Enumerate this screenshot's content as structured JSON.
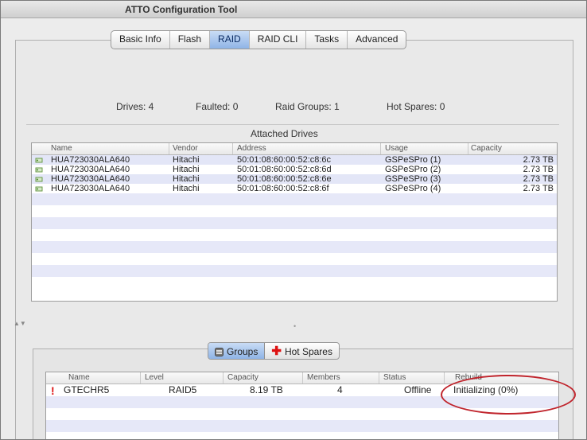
{
  "window": {
    "title": "ATTO Configuration Tool"
  },
  "tabs": [
    {
      "label": "Basic Info",
      "active": false
    },
    {
      "label": "Flash",
      "active": false
    },
    {
      "label": "RAID",
      "active": true
    },
    {
      "label": "RAID CLI",
      "active": false
    },
    {
      "label": "Tasks",
      "active": false
    },
    {
      "label": "Advanced",
      "active": false
    }
  ],
  "summary": {
    "drives": "Drives:  4",
    "faulted": "Faulted:  0",
    "raid_groups": "Raid Groups:  1",
    "hot_spares": "Hot Spares:  0"
  },
  "attached_drives": {
    "title": "Attached Drives",
    "columns": [
      "Name",
      "Vendor",
      "Address",
      "Usage",
      "Capacity"
    ],
    "rows": [
      {
        "name": "HUA723030ALA640",
        "vendor": "Hitachi",
        "address": "50:01:08:60:00:52:c8:6c",
        "usage": "GSPeSPro (1)",
        "capacity": "2.73 TB"
      },
      {
        "name": "HUA723030ALA640",
        "vendor": "Hitachi",
        "address": "50:01:08:60:00:52:c8:6d",
        "usage": "GSPeSPro (2)",
        "capacity": "2.73 TB"
      },
      {
        "name": "HUA723030ALA640",
        "vendor": "Hitachi",
        "address": "50:01:08:60:00:52:c8:6e",
        "usage": "GSPeSPro (3)",
        "capacity": "2.73 TB"
      },
      {
        "name": "HUA723030ALA640",
        "vendor": "Hitachi",
        "address": "50:01:08:60:00:52:c8:6f",
        "usage": "GSPeSPro (4)",
        "capacity": "2.73 TB"
      }
    ]
  },
  "segments": {
    "groups": "Groups",
    "hot_spares": "Hot Spares"
  },
  "groups_table": {
    "columns": [
      "Name",
      "Level",
      "Capacity",
      "Members",
      "Status",
      "Rebuild"
    ],
    "rows": [
      {
        "name": "GTECHR5",
        "level": "RAID5",
        "capacity": "8.19 TB",
        "members": "4",
        "status": "Offline",
        "rebuild": "Initializing (0%)"
      }
    ]
  },
  "colors": {
    "highlight_circle": "#c0242c",
    "alt_row": "#e3e6f7",
    "selected_tab": "#8fb4e6"
  }
}
